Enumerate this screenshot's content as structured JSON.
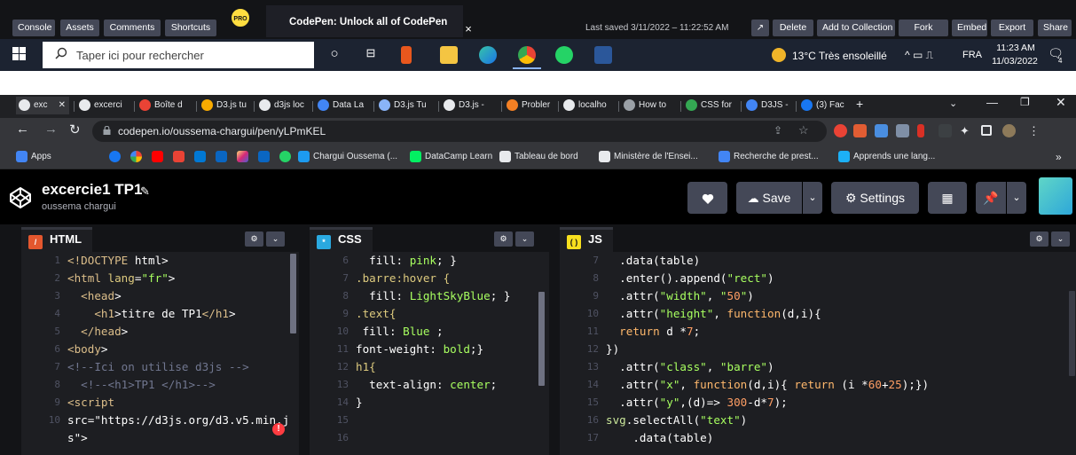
{
  "codepen_footer": {
    "buttons_left": [
      "Console",
      "Assets",
      "Comments",
      "Shortcuts"
    ],
    "pro_badge": "PRO",
    "promo_title": "CodePen: Unlock all of CodePen",
    "promo_close": "×",
    "last_saved": "Last saved 3/11/2022 – 11:22:52 AM",
    "buttons_right": [
      "Delete",
      "Add to Collection",
      "Fork",
      "Embed",
      "Export",
      "Share"
    ]
  },
  "taskbar": {
    "search_placeholder": "Taper ici pour rechercher",
    "weather": "13°C  Très ensoleillé",
    "language": "FRA",
    "time": "11:23 AM",
    "date": "11/03/2022",
    "notifications": "4"
  },
  "browser": {
    "tabs": [
      {
        "label": "exc",
        "fav_color": "#e8eaed",
        "active": true
      },
      {
        "label": "excerci",
        "fav_color": "#e8eaed"
      },
      {
        "label": "Boîte d",
        "fav_color": "#ea4335"
      },
      {
        "label": "D3.js tu",
        "fav_color": "#f9ab00"
      },
      {
        "label": "d3js loc",
        "fav_color": "#e8eaed"
      },
      {
        "label": "Data La",
        "fav_color": "#4285f4"
      },
      {
        "label": "D3.js Tu",
        "fav_color": "#8ab4f8"
      },
      {
        "label": "D3.js -",
        "fav_color": "#e8eaed"
      },
      {
        "label": "Probler",
        "fav_color": "#f48024"
      },
      {
        "label": "localho",
        "fav_color": "#e8eaed"
      },
      {
        "label": "How to",
        "fav_color": "#9aa0a6"
      },
      {
        "label": "CSS for",
        "fav_color": "#34a853"
      },
      {
        "label": "D3JS -",
        "fav_color": "#4285f4"
      },
      {
        "label": "(3) Fac",
        "fav_color": "#1877f2"
      }
    ],
    "new_tab": "+",
    "url": "codepen.io/oussema-chargui/pen/yLPmKEL",
    "bookmarks": [
      {
        "label": "Apps",
        "fav_color": "#4285f4"
      },
      {
        "label": "Chargui Oussema (...",
        "fav_color": "#1d9bf0"
      },
      {
        "label": "DataCamp Learn",
        "fav_color": "#03ef62"
      },
      {
        "label": "Tableau de bord",
        "fav_color": "#e8eaed"
      },
      {
        "label": "Ministère de l'Ensei...",
        "fav_color": "#e8eaed"
      },
      {
        "label": "Recherche de prest...",
        "fav_color": "#4285f4"
      },
      {
        "label": "Apprends une lang...",
        "fav_color": "#1cb0f6"
      }
    ],
    "bookmarks_more": "»"
  },
  "pen": {
    "title": "excercie1 TP1",
    "author": "oussema chargui",
    "save_label": "Save",
    "settings_label": "Settings"
  },
  "editors": {
    "html": {
      "label": "HTML",
      "lines": [
        {
          "n": "1",
          "t": "<!DOCTYPE html>"
        },
        {
          "n": "2",
          "t": "<html lang=\"fr\">"
        },
        {
          "n": "3",
          "t": "  <head>"
        },
        {
          "n": "4",
          "t": "    <h1>titre de TP1</h1>"
        },
        {
          "n": "5",
          "t": "  </head>"
        },
        {
          "n": "6",
          "t": "<body>"
        },
        {
          "n": "7",
          "t": "<!--Ici on utilise d3js -->"
        },
        {
          "n": "8",
          "t": "  <!--<h1>TP1 </h1>-->"
        },
        {
          "n": "9",
          "t": "<script"
        },
        {
          "n": "10",
          "t": "src=\"https://d3js.org/d3.v5.min.j"
        },
        {
          "n": "",
          "t": "s\">"
        }
      ]
    },
    "css": {
      "label": "CSS",
      "lines": [
        {
          "n": "6",
          "t": "  fill: pink; }"
        },
        {
          "n": "7",
          "t": ".barre:hover {"
        },
        {
          "n": "8",
          "t": "  fill: LightSkyBlue; }"
        },
        {
          "n": "9",
          "t": ".text{"
        },
        {
          "n": "10",
          "t": " fill: Blue ;"
        },
        {
          "n": "11",
          "t": "font-weight: bold;}"
        },
        {
          "n": "12",
          "t": "h1{"
        },
        {
          "n": "13",
          "t": "  text-align: center;"
        },
        {
          "n": "14",
          "t": "}"
        },
        {
          "n": "15",
          "t": ""
        },
        {
          "n": "16",
          "t": ""
        }
      ]
    },
    "js": {
      "label": "JS",
      "lines": [
        {
          "n": "7",
          "t": "  .data(table)"
        },
        {
          "n": "8",
          "t": "  .enter().append(\"rect\")"
        },
        {
          "n": "9",
          "t": "  .attr(\"width\", \"50\")"
        },
        {
          "n": "10",
          "t": "  .attr(\"height\", function(d,i){"
        },
        {
          "n": "11",
          "t": "  return d *7;"
        },
        {
          "n": "12",
          "t": "})"
        },
        {
          "n": "13",
          "t": "  .attr(\"class\", \"barre\")"
        },
        {
          "n": "14",
          "t": "  .attr(\"x\", function(d,i){ return (i *60+25);})"
        },
        {
          "n": "15",
          "t": "  .attr(\"y\",(d)=> 300-d*7);"
        },
        {
          "n": "16",
          "t": "svg.selectAll(\"text\")"
        },
        {
          "n": "17",
          "t": "    .data(table)"
        }
      ]
    }
  },
  "icons": {
    "settings": "gear-icon",
    "collapse": "chevron-down-icon",
    "heart": "heart-icon",
    "save": "cloud-icon",
    "layout": "layout-grid-icon",
    "pin": "pin-icon"
  }
}
